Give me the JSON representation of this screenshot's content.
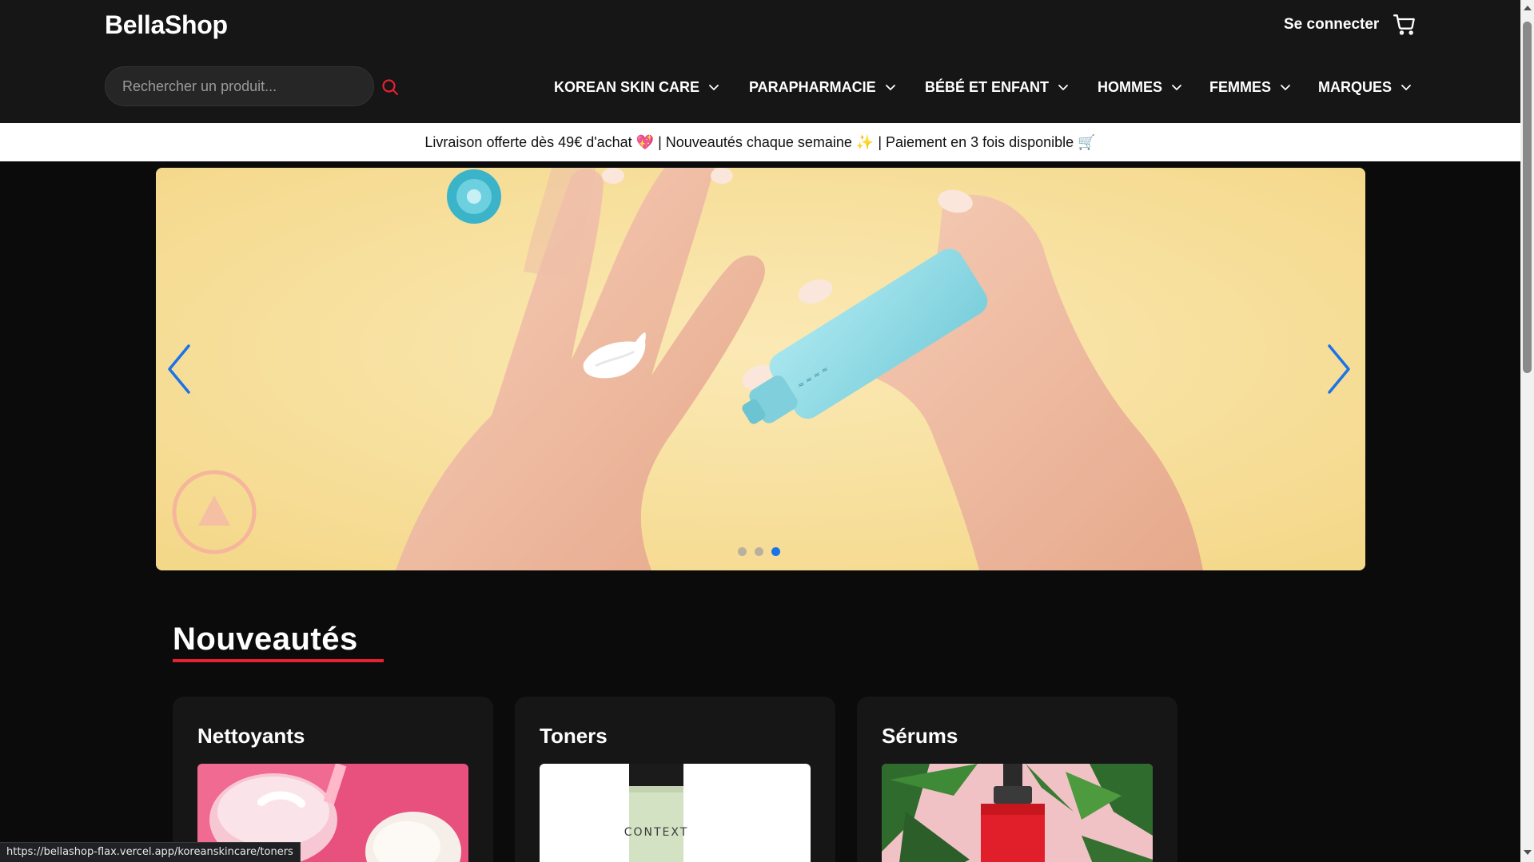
{
  "header": {
    "logo": "BellaShop",
    "login_label": "Se connecter",
    "cart_icon": "cart-icon",
    "search": {
      "placeholder": "Rechercher un produit...",
      "value": "",
      "icon": "search-icon"
    },
    "nav": [
      {
        "label": "KOREAN SKIN CARE"
      },
      {
        "label": "PARAPHARMACIE"
      },
      {
        "label": "BÉBÉ ET ENFANT"
      },
      {
        "label": "HOMMES"
      },
      {
        "label": "FEMMES"
      },
      {
        "label": "MARQUES"
      }
    ]
  },
  "banner": {
    "text": "Livraison offerte dès 49€ d'achat 💖 | Nouveautés chaque semaine ✨ | Paiement en 3 fois disponible 🛒"
  },
  "carousel": {
    "slide_count": 3,
    "active_index": 2,
    "prev_icon": "chevron-left-icon",
    "next_icon": "chevron-right-icon"
  },
  "new_section": {
    "title": "Nouveautés",
    "cards": [
      {
        "title": "Nettoyants"
      },
      {
        "title": "Toners",
        "product_label": "CONTEXT"
      },
      {
        "title": "Sérums"
      }
    ]
  },
  "status_url": "https://bellashop-flax.vercel.app/koreanskincare/toners",
  "colors": {
    "header_bg": "#161616",
    "page_bg": "#0b0b0b",
    "accent_red": "#e5212f",
    "carousel_blue": "#1a73e8"
  }
}
